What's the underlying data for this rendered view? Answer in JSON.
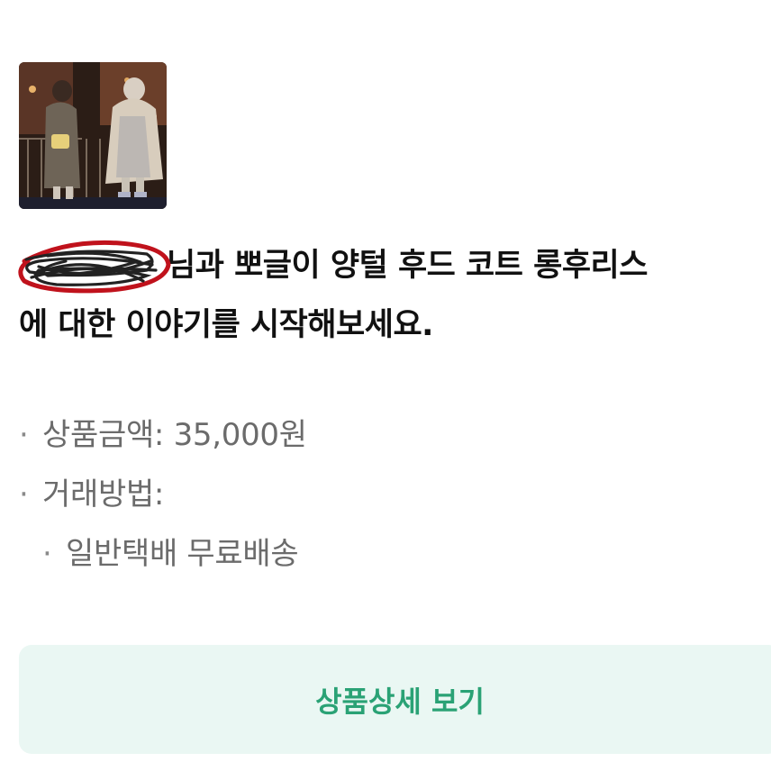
{
  "product": {
    "thumbnail_icon": "product-photo",
    "title_line_1": "님과 뽀글이 양털 후드 코트 롱후리스",
    "title_line_2": "에 대한 이야기를 시작해보세요.",
    "redacted_name": ""
  },
  "info": {
    "bullet": "·",
    "price_label": "상품금액: 35,000원",
    "method_label": "거래방법:",
    "method_value": "일반택배 무료배송"
  },
  "button": {
    "detail_label": "상품상세 보기"
  },
  "colors": {
    "accent_text": "#2aa275",
    "button_bg": "#eaf7f3",
    "redaction_red": "#c0121c"
  }
}
